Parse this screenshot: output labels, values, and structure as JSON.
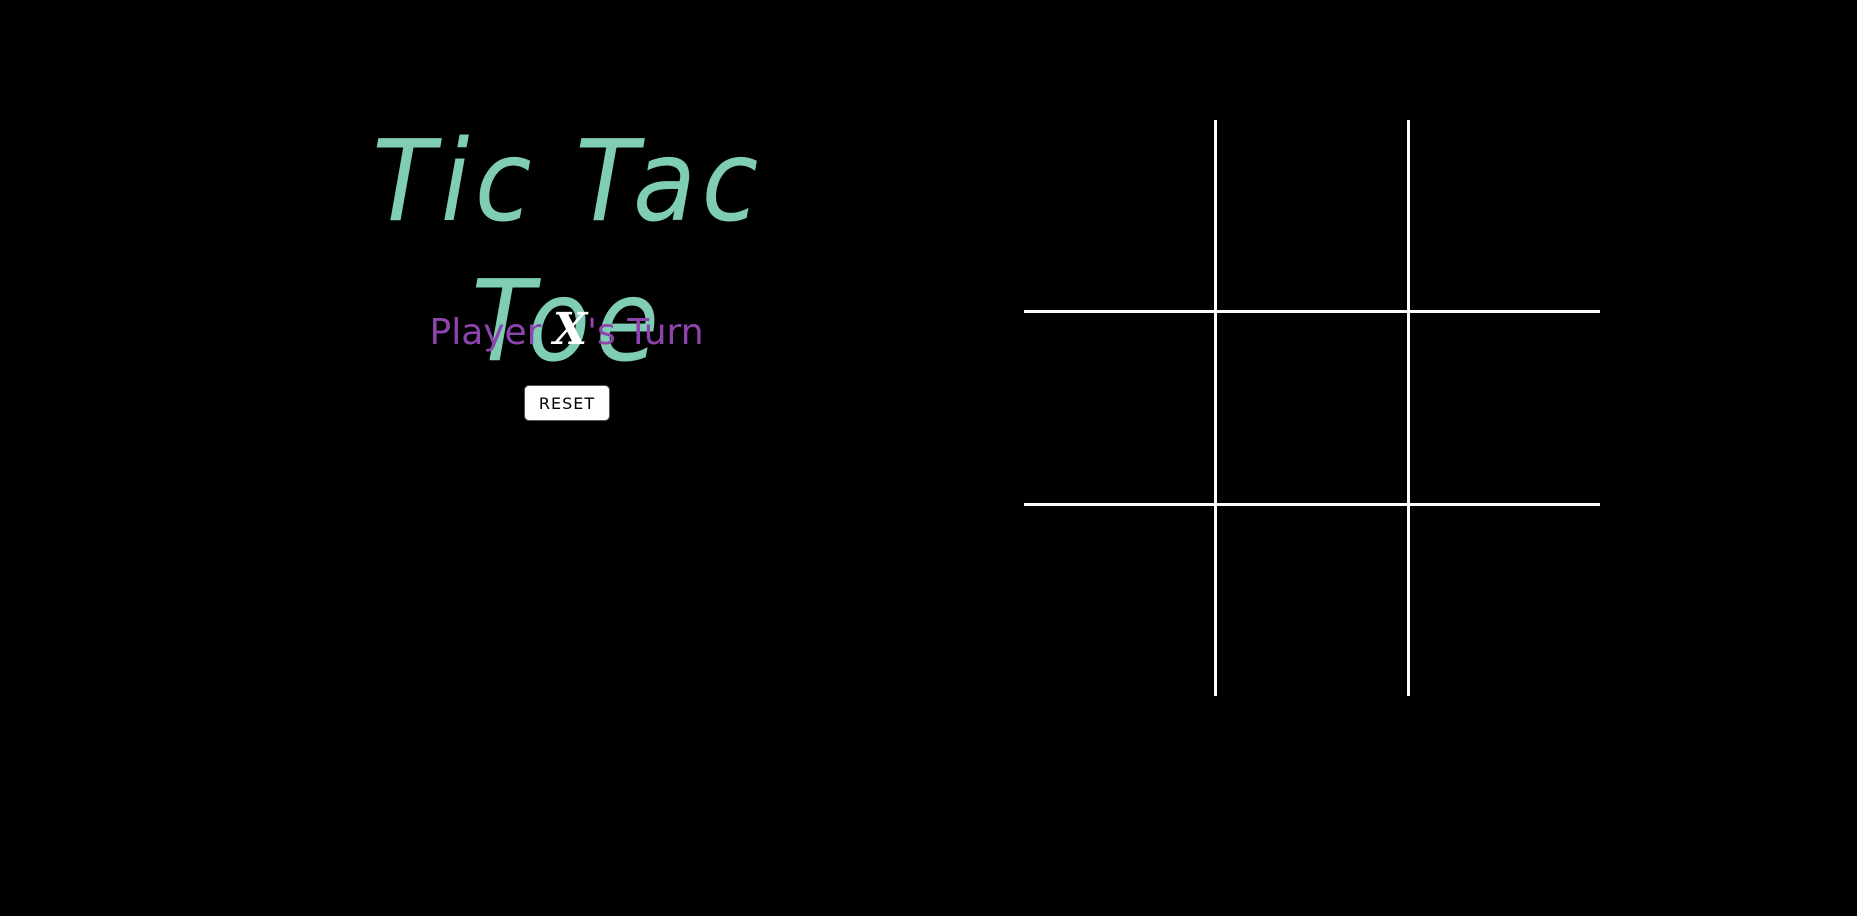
{
  "title": "Tic Tac Toe",
  "status": {
    "prefix": "Player ",
    "current_player": "X",
    "suffix": "'s Turn"
  },
  "reset_label": "RESET",
  "board": {
    "cells": [
      "",
      "",
      "",
      "",
      "",
      "",
      "",
      "",
      ""
    ]
  },
  "colors": {
    "background": "#000000",
    "title": "#7ecdb4",
    "status": "#8e44ad",
    "grid": "#ffffff"
  }
}
